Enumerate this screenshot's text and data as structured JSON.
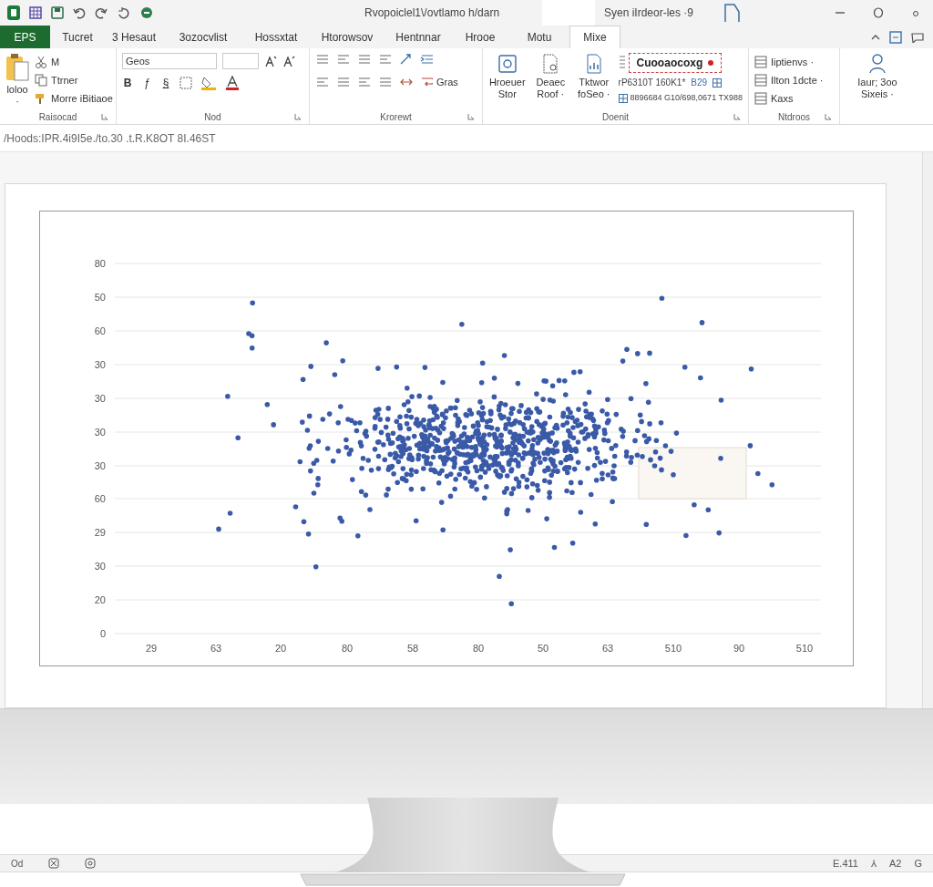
{
  "window": {
    "title": "Rvopoiclel1\\/ovtlamo  h/darn",
    "search": "Syen iIrdeor-les ·9"
  },
  "tabs": [
    {
      "label": "EPS",
      "kind": "file"
    },
    {
      "label": "Tucret",
      "kind": "tab",
      "selected": false
    },
    {
      "label": "3 Hesaut",
      "kind": "tab",
      "selected": false
    },
    {
      "label": "3ozocvlist",
      "kind": "tab",
      "selected": false
    },
    {
      "label": "Hossxtat",
      "kind": "tab",
      "selected": false
    },
    {
      "label": "Htorowsov",
      "kind": "tab",
      "selected": false
    },
    {
      "label": "Hentnnar",
      "kind": "tab",
      "selected": false
    },
    {
      "label": "Hrooe",
      "kind": "tab",
      "selected": false
    },
    {
      "label": "Motu",
      "kind": "tab",
      "selected": false
    },
    {
      "label": "Mixe",
      "kind": "tab",
      "selected": true
    }
  ],
  "ribbon": [
    {
      "kind": "clipboard",
      "label": "Raisocad",
      "large": "loloo ·",
      "items": [
        "M",
        "Ttrner",
        "Morre iBitiaoe"
      ]
    },
    {
      "kind": "font",
      "label": "Nod",
      "font": "Geos",
      "format_buttons": [
        "B",
        "ƒ",
        "§"
      ]
    },
    {
      "kind": "alignment",
      "label": "Krorewt",
      "wrap": "Gras"
    },
    {
      "kind": "styles",
      "label": "Doenit",
      "buttons": [
        "Hroeuer Stor",
        "Deaec Roof ·",
        "Tktwor foSeo ·"
      ],
      "style_box": "Cuooaocoxg",
      "row_1": [
        "rP6310T 160K1*",
        "B29"
      ],
      "row_2": "8896684 G10/698,0671 TX988"
    },
    {
      "kind": "cells",
      "label": "Ntdroos",
      "items": [
        "Iiptienvs ·",
        "Ilton 1dcte ·",
        "Kaxs"
      ]
    },
    {
      "kind": "editing",
      "large": "Iaur; 3oo Sixeis ·"
    }
  ],
  "formula_bar": "/Hoods:IPR.4i9I5e./to.30 .t.R.K8OT  8I.46ST",
  "chart": {
    "y_labels": [
      "80",
      "50",
      "60",
      "30",
      "30",
      "30",
      "30",
      "60",
      "29",
      "30",
      "20",
      "0"
    ],
    "x_labels": [
      "29",
      "63",
      "20",
      "80",
      "58",
      "80",
      "50",
      "63",
      "510",
      "90",
      "510"
    ]
  },
  "status_bar": {
    "left": "Od",
    "right": [
      "E.411",
      "⅄",
      "A2",
      "G"
    ]
  }
}
